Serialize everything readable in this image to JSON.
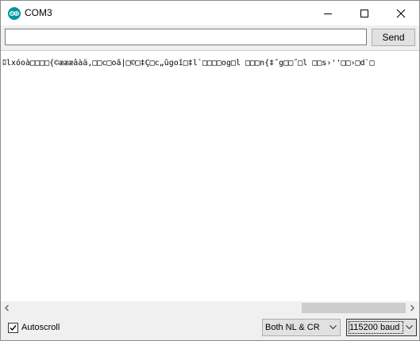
{
  "window": {
    "title": "COM3",
    "app_icon": "arduino-infinity-icon",
    "controls": [
      "minimize-icon",
      "maximize-icon",
      "close-icon"
    ]
  },
  "send_bar": {
    "input_value": "",
    "send_label": "Send"
  },
  "output": {
    "text": "ﾛlxóoà□□□□{©æææâàä,□□c□oã|□©□‡Ç□c„ûgoî□‡l`□□□□og□l □□□n{‡˝g□□˝□l □□s›''□□›□d`□"
  },
  "scrollbar": {
    "left_icon": "chevron-left-icon",
    "right_icon": "chevron-right-icon"
  },
  "footer": {
    "autoscroll_label": "Autoscroll",
    "autoscroll_checked": true,
    "line_ending": "Both NL & CR",
    "baud": "115200 baud"
  },
  "colors": {
    "accent": "#00979c",
    "button_bg": "#e1e1e1"
  }
}
